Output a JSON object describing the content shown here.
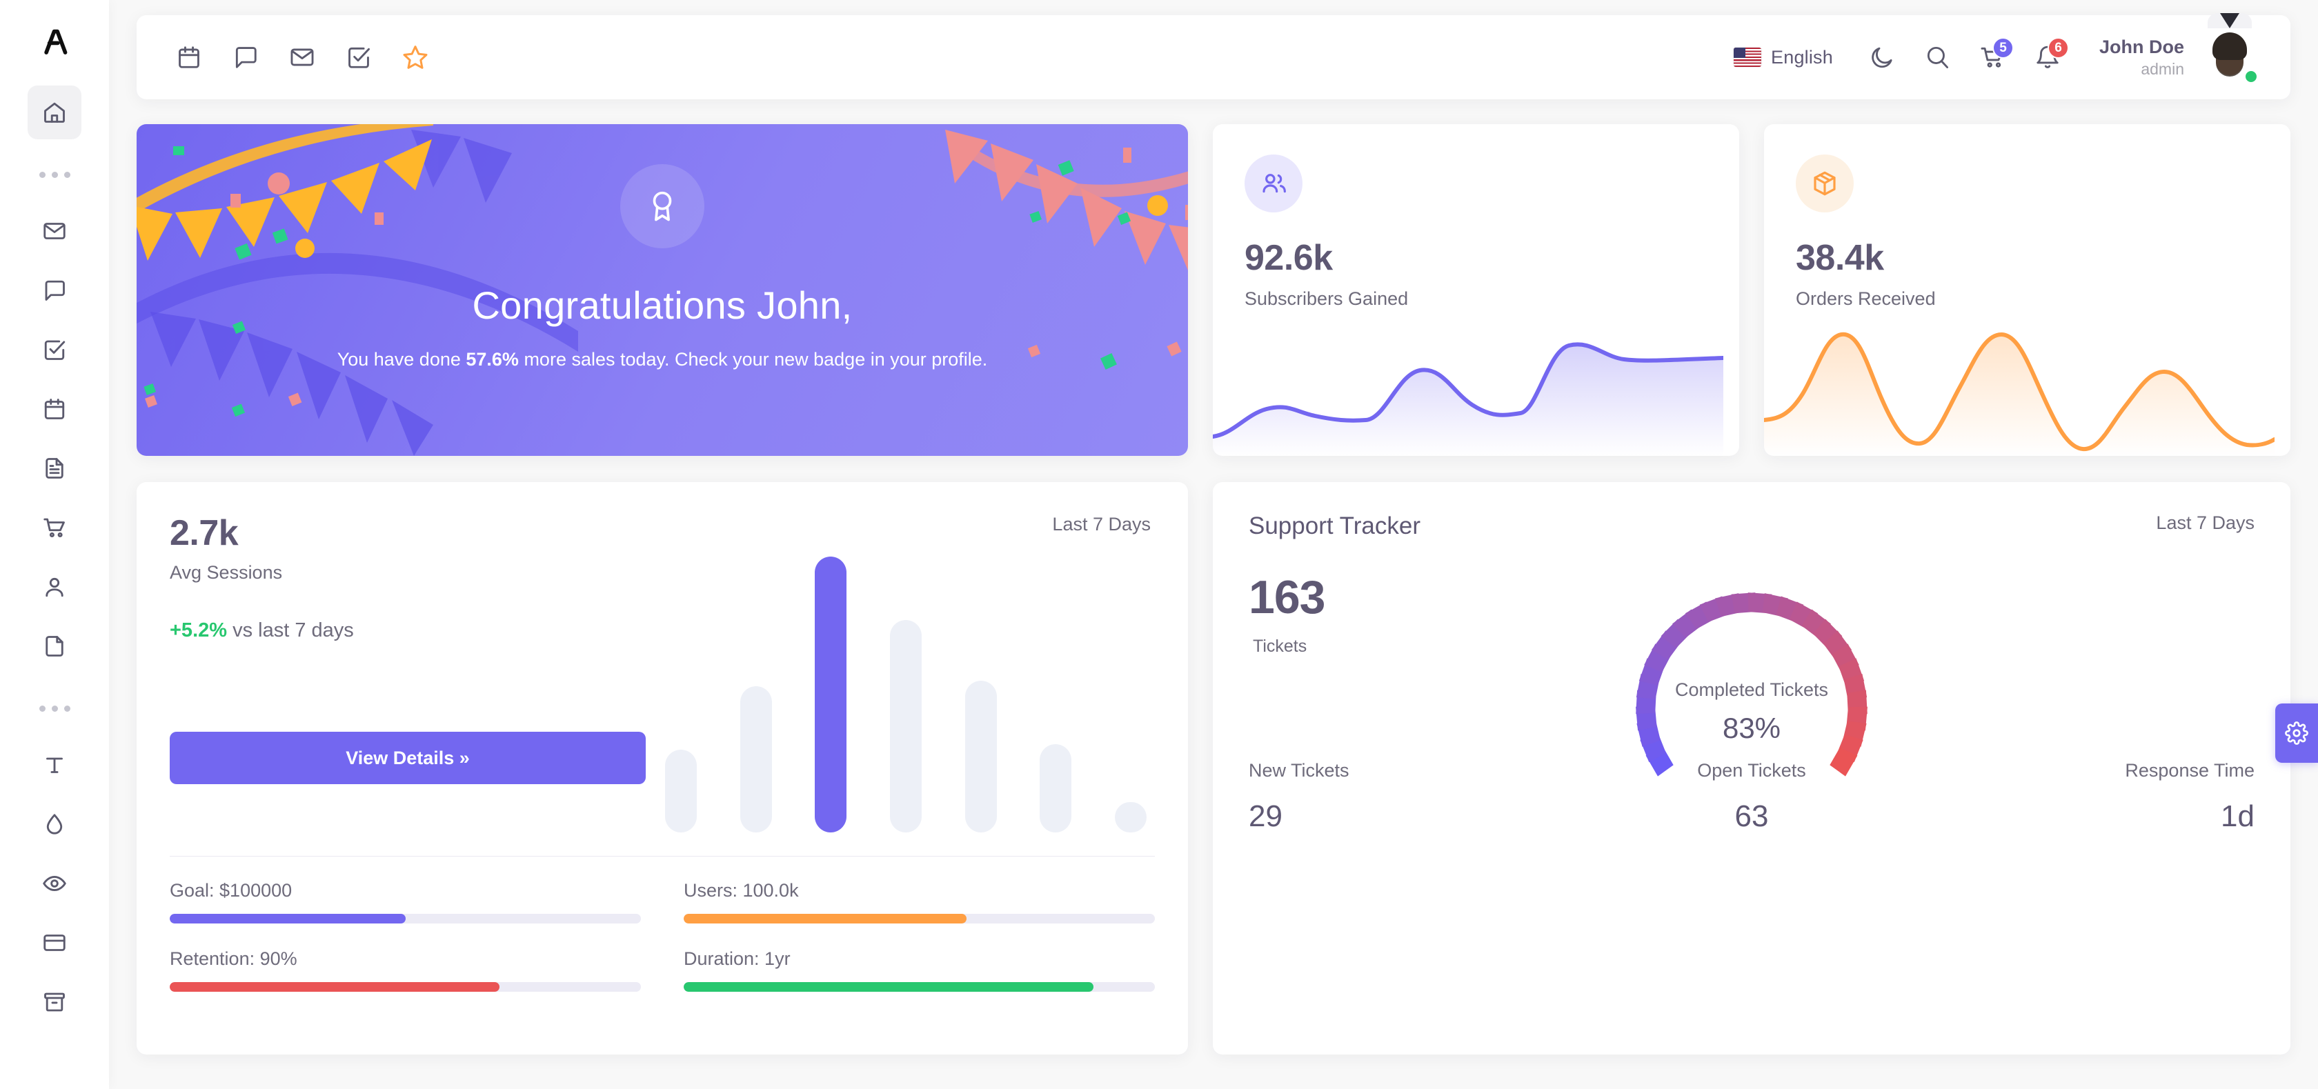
{
  "sidebar": {
    "logo_name": "brand-logo",
    "items": [
      {
        "name": "home",
        "icon": "home-icon",
        "active": true
      },
      {
        "name": "divider-dots-1",
        "icon": "ellipsis-icon",
        "divider": true
      },
      {
        "name": "email",
        "icon": "mail-icon"
      },
      {
        "name": "chat",
        "icon": "chat-bubble-icon"
      },
      {
        "name": "todo",
        "icon": "check-square-icon"
      },
      {
        "name": "calendar",
        "icon": "calendar-icon"
      },
      {
        "name": "invoice",
        "icon": "file-text-icon"
      },
      {
        "name": "ecommerce",
        "icon": "shopping-cart-icon"
      },
      {
        "name": "user",
        "icon": "user-icon"
      },
      {
        "name": "pages",
        "icon": "file-icon"
      },
      {
        "name": "divider-dots-2",
        "icon": "ellipsis-icon",
        "divider": true
      },
      {
        "name": "typography",
        "icon": "type-icon"
      },
      {
        "name": "colors",
        "icon": "droplet-icon"
      },
      {
        "name": "icons",
        "icon": "eye-icon"
      },
      {
        "name": "cards",
        "icon": "credit-card-icon"
      },
      {
        "name": "components",
        "icon": "archive-icon"
      }
    ]
  },
  "navbar": {
    "tools": [
      {
        "name": "calendar",
        "icon": "calendar-icon"
      },
      {
        "name": "chat",
        "icon": "chat-bubble-icon"
      },
      {
        "name": "email",
        "icon": "mail-icon"
      },
      {
        "name": "todo",
        "icon": "check-square-icon"
      },
      {
        "name": "bookmark",
        "icon": "star-icon"
      }
    ],
    "language": "English",
    "flag_icon": "us-flag-icon",
    "dark_mode_icon": "moon-icon",
    "search_icon": "search-icon",
    "cart_icon": "shopping-cart-icon",
    "cart_count": "5",
    "bell_icon": "bell-icon",
    "bell_count": "6",
    "user_name": "John Doe",
    "user_role": "admin"
  },
  "congrats": {
    "title": "Congratulations John,",
    "sub_pre": "You have done ",
    "sub_value": "57.6%",
    "sub_post": " more sales today. Check your new badge in your profile.",
    "badge_icon": "award-icon"
  },
  "stats": [
    {
      "value": "92.6k",
      "label": "Subscribers Gained",
      "icon": "users-icon",
      "accent": "#7367f0",
      "accent_bg": "#e9e7fd"
    },
    {
      "value": "38.4k",
      "label": "Orders Received",
      "icon": "package-icon",
      "accent": "#ff9f43",
      "accent_bg": "#fdf1e3"
    }
  ],
  "sessions": {
    "value": "2.7k",
    "label": "Avg Sessions",
    "delta": "+5.2%",
    "delta_text": " vs last 7 days",
    "period": "Last 7 Days",
    "button": "View Details »",
    "progress": [
      {
        "label": "Goal: $100000",
        "percent": 50,
        "color": "#7367f0"
      },
      {
        "label": "Users: 100.0k",
        "percent": 60,
        "color": "#ff9f43"
      },
      {
        "label": "Retention: 90%",
        "percent": 70,
        "color": "#ea5455"
      },
      {
        "label": "Duration: 1yr",
        "percent": 87,
        "color": "#28c76f"
      }
    ]
  },
  "support": {
    "title": "Support Tracker",
    "period": "Last 7 Days",
    "tickets_value": "163",
    "tickets_label": "Tickets",
    "gauge_label": "Completed Tickets",
    "gauge_pct": "83%",
    "footer": [
      {
        "label": "New Tickets",
        "value": "29"
      },
      {
        "label": "Open Tickets",
        "value": "63"
      },
      {
        "label": "Response Time",
        "value": "1d"
      }
    ]
  },
  "settings_tab": {
    "icon": "gear-icon"
  },
  "chart_data": [
    {
      "type": "area",
      "title": "Subscribers Gained",
      "series": [
        {
          "name": "Subscribers",
          "values": [
            12,
            18,
            30,
            28,
            24,
            26,
            52,
            60,
            48,
            34,
            30,
            70,
            78,
            74,
            72
          ]
        }
      ],
      "x": [
        1,
        2,
        3,
        4,
        5,
        6,
        7,
        8,
        9,
        10,
        11,
        12,
        13,
        14,
        15
      ],
      "color": "#7367f0",
      "grid": false,
      "legend": "none",
      "xlabel": "",
      "ylabel": ""
    },
    {
      "type": "area",
      "title": "Orders Received",
      "series": [
        {
          "name": "Orders",
          "values": [
            10,
            22,
            78,
            40,
            6,
            18,
            60,
            80,
            36,
            4,
            24,
            56,
            62,
            40,
            22
          ]
        }
      ],
      "x": [
        1,
        2,
        3,
        4,
        5,
        6,
        7,
        8,
        9,
        10,
        11,
        12,
        13,
        14,
        15
      ],
      "color": "#ff9f43",
      "grid": false,
      "legend": "none",
      "xlabel": "",
      "ylabel": ""
    },
    {
      "type": "bar",
      "title": "Avg Sessions",
      "subtitle": "Last 7 Days",
      "categories": [
        "1",
        "2",
        "3",
        "4",
        "5",
        "6",
        "7"
      ],
      "values": [
        30,
        53,
        100,
        77,
        55,
        32,
        11
      ],
      "highlight_index": 2,
      "bar_color": "#edf0f7",
      "highlight_color": "#7367f0",
      "ylim": [
        0,
        100
      ],
      "grid": false,
      "xlabel": "",
      "ylabel": ""
    },
    {
      "type": "pie",
      "title": "Completed Tickets",
      "subtitle": "Support Tracker",
      "categories": [
        "Completed",
        "Remaining"
      ],
      "values": [
        83,
        17
      ],
      "labels": [
        "83%"
      ],
      "gradient_from": "#6b5cf5",
      "gradient_to": "#ea5455",
      "ticks": 30,
      "legend": "none"
    }
  ]
}
